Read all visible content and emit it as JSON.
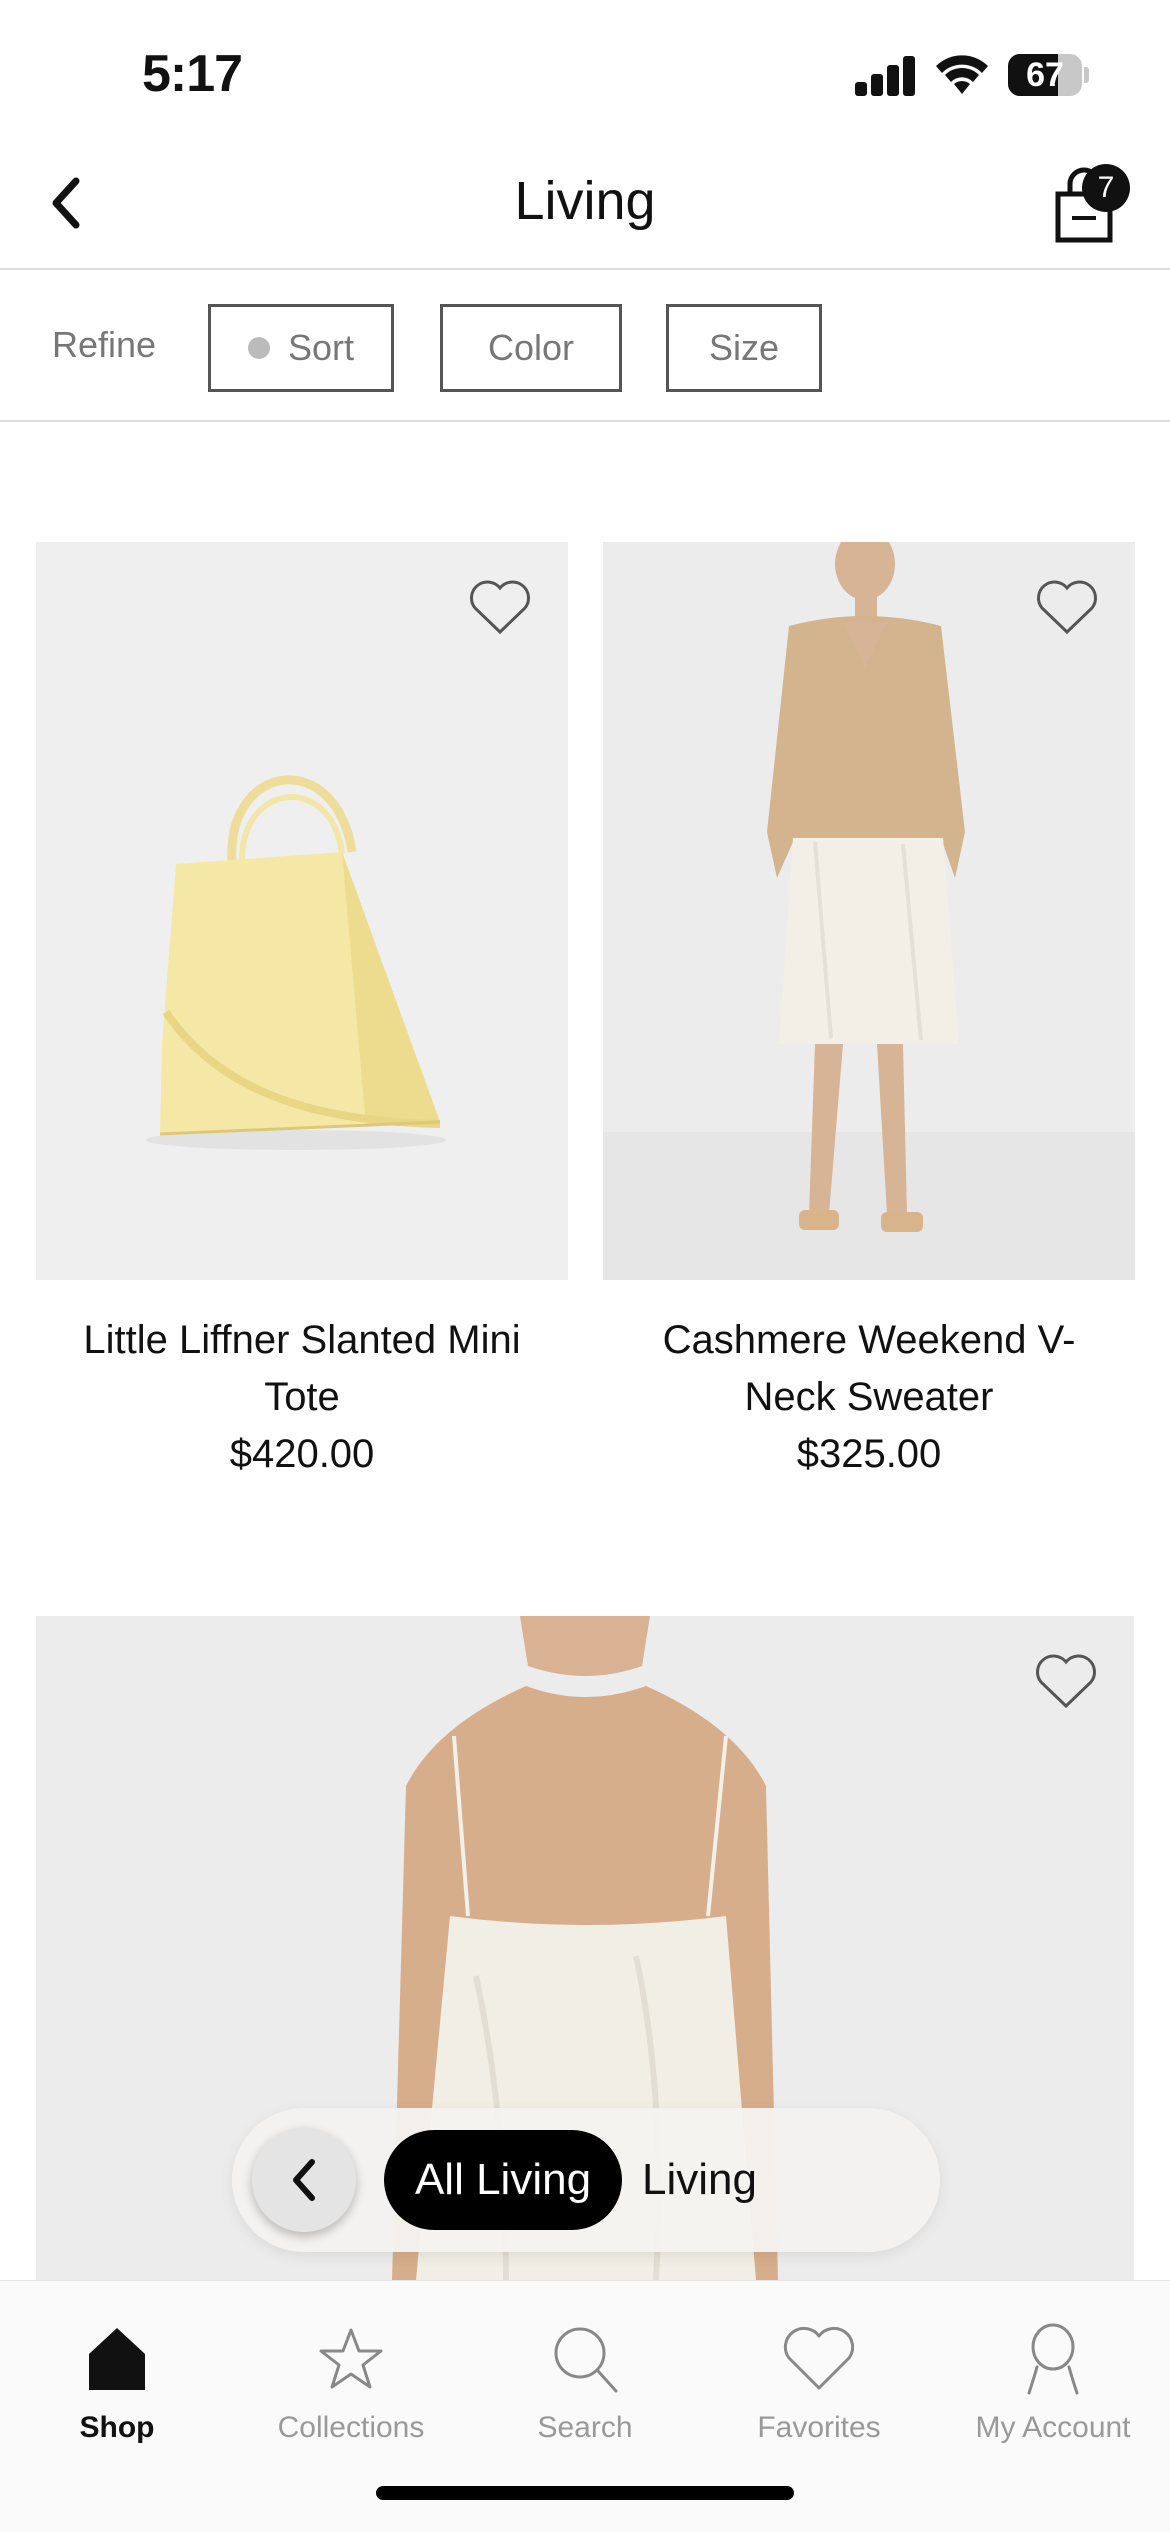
{
  "status_bar": {
    "time": "5:17",
    "battery_percent": "67",
    "battery_level": 0.67
  },
  "header": {
    "title": "Living",
    "bag_count": "7"
  },
  "refine": {
    "label": "Refine",
    "sort": "Sort",
    "color": "Color",
    "size": "Size"
  },
  "products": [
    {
      "name_line1": "Little Liffner Slanted Mini",
      "name_line2": "Tote",
      "price": "$420.00"
    },
    {
      "name_line1": "Cashmere Weekend V-",
      "name_line2": "Neck Sweater",
      "price": "$325.00"
    }
  ],
  "chips": {
    "active": "All Living",
    "inactive": "Living"
  },
  "tabs": [
    {
      "label": "Shop",
      "icon": "home-icon"
    },
    {
      "label": "Collections",
      "icon": "star-icon"
    },
    {
      "label": "Search",
      "icon": "search-icon"
    },
    {
      "label": "Favorites",
      "icon": "heart-icon"
    },
    {
      "label": "My Account",
      "icon": "person-icon"
    }
  ],
  "colors": {
    "accent": "#000000",
    "inactive_text": "#999999",
    "image_bg": "#f1f1f1"
  }
}
